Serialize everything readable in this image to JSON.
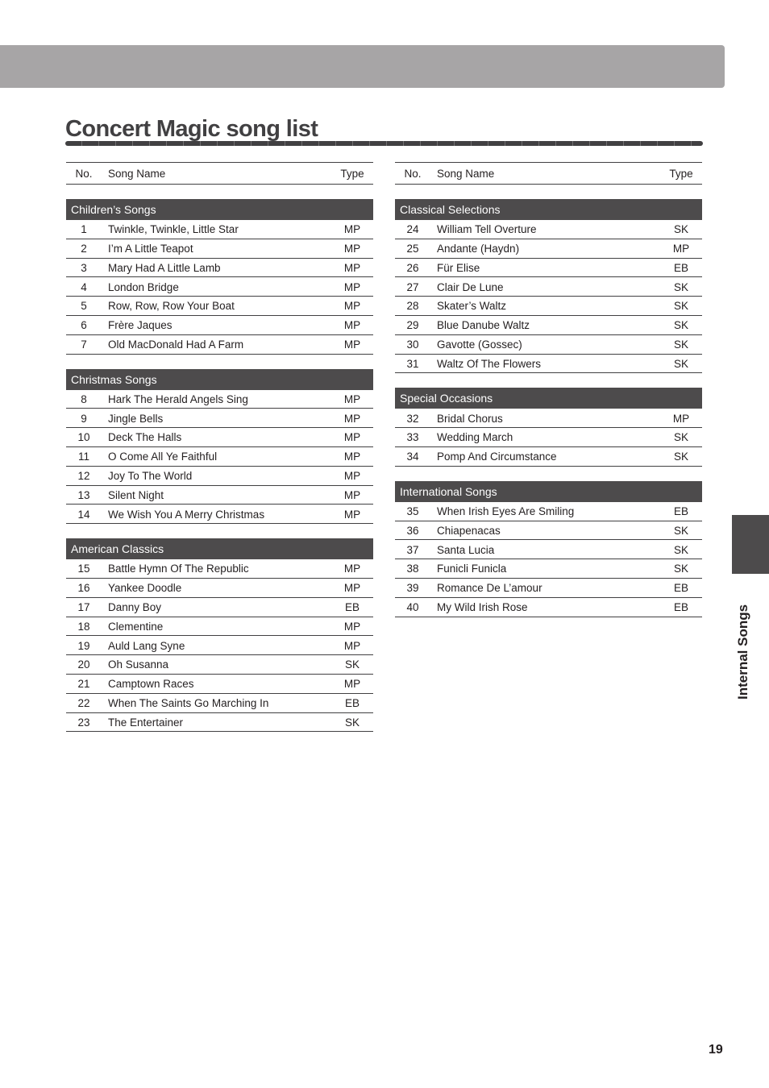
{
  "page": {
    "title": "Concert Magic song list",
    "side_tab_label": "Internal Songs",
    "page_number": "19"
  },
  "columns_header": {
    "no": "No.",
    "name": "Song Name",
    "type": "Type"
  },
  "left_sections": [
    {
      "title": "Children’s Songs",
      "songs": [
        {
          "no": "1",
          "name": "Twinkle, Twinkle, Little Star",
          "type": "MP"
        },
        {
          "no": "2",
          "name": "I’m A Little Teapot",
          "type": "MP"
        },
        {
          "no": "3",
          "name": "Mary Had A Little Lamb",
          "type": "MP"
        },
        {
          "no": "4",
          "name": "London Bridge",
          "type": "MP"
        },
        {
          "no": "5",
          "name": "Row, Row, Row Your Boat",
          "type": "MP"
        },
        {
          "no": "6",
          "name": "Frère Jaques",
          "type": "MP"
        },
        {
          "no": "7",
          "name": "Old MacDonald Had A Farm",
          "type": "MP"
        }
      ]
    },
    {
      "title": "Christmas Songs",
      "songs": [
        {
          "no": "8",
          "name": "Hark The Herald Angels Sing",
          "type": "MP"
        },
        {
          "no": "9",
          "name": "Jingle Bells",
          "type": "MP"
        },
        {
          "no": "10",
          "name": "Deck The Halls",
          "type": "MP"
        },
        {
          "no": "11",
          "name": "O Come All Ye Faithful",
          "type": "MP"
        },
        {
          "no": "12",
          "name": "Joy To The World",
          "type": "MP"
        },
        {
          "no": "13",
          "name": "Silent Night",
          "type": "MP"
        },
        {
          "no": "14",
          "name": "We Wish You A Merry Christmas",
          "type": "MP"
        }
      ]
    },
    {
      "title": "American Classics",
      "songs": [
        {
          "no": "15",
          "name": "Battle Hymn Of The Republic",
          "type": "MP"
        },
        {
          "no": "16",
          "name": "Yankee Doodle",
          "type": "MP"
        },
        {
          "no": "17",
          "name": "Danny Boy",
          "type": "EB"
        },
        {
          "no": "18",
          "name": "Clementine",
          "type": "MP"
        },
        {
          "no": "19",
          "name": "Auld Lang Syne",
          "type": "MP"
        },
        {
          "no": "20",
          "name": "Oh Susanna",
          "type": "SK"
        },
        {
          "no": "21",
          "name": "Camptown Races",
          "type": "MP"
        },
        {
          "no": "22",
          "name": "When The Saints Go Marching In",
          "type": "EB"
        },
        {
          "no": "23",
          "name": "The Entertainer",
          "type": "SK"
        }
      ]
    }
  ],
  "right_sections": [
    {
      "title": "Classical Selections",
      "songs": [
        {
          "no": "24",
          "name": "William Tell Overture",
          "type": "SK"
        },
        {
          "no": "25",
          "name": "Andante (Haydn)",
          "type": "MP"
        },
        {
          "no": "26",
          "name": "Für Elise",
          "type": "EB"
        },
        {
          "no": "27",
          "name": "Clair De Lune",
          "type": "SK"
        },
        {
          "no": "28",
          "name": "Skater’s Waltz",
          "type": "SK"
        },
        {
          "no": "29",
          "name": "Blue Danube Waltz",
          "type": "SK"
        },
        {
          "no": "30",
          "name": "Gavotte (Gossec)",
          "type": "SK"
        },
        {
          "no": "31",
          "name": "Waltz Of The Flowers",
          "type": "SK"
        }
      ]
    },
    {
      "title": "Special Occasions",
      "songs": [
        {
          "no": "32",
          "name": "Bridal Chorus",
          "type": "MP"
        },
        {
          "no": "33",
          "name": "Wedding March",
          "type": "SK"
        },
        {
          "no": "34",
          "name": "Pomp And Circumstance",
          "type": "SK"
        }
      ]
    },
    {
      "title": "International Songs",
      "songs": [
        {
          "no": "35",
          "name": "When Irish Eyes Are Smiling",
          "type": "EB"
        },
        {
          "no": "36",
          "name": "Chiapenacas",
          "type": "SK"
        },
        {
          "no": "37",
          "name": "Santa Lucia",
          "type": "SK"
        },
        {
          "no": "38",
          "name": "Funicli Funicla",
          "type": "SK"
        },
        {
          "no": "39",
          "name": "Romance De L’amour",
          "type": "EB"
        },
        {
          "no": "40",
          "name": "My Wild Irish Rose",
          "type": "EB"
        }
      ]
    }
  ]
}
